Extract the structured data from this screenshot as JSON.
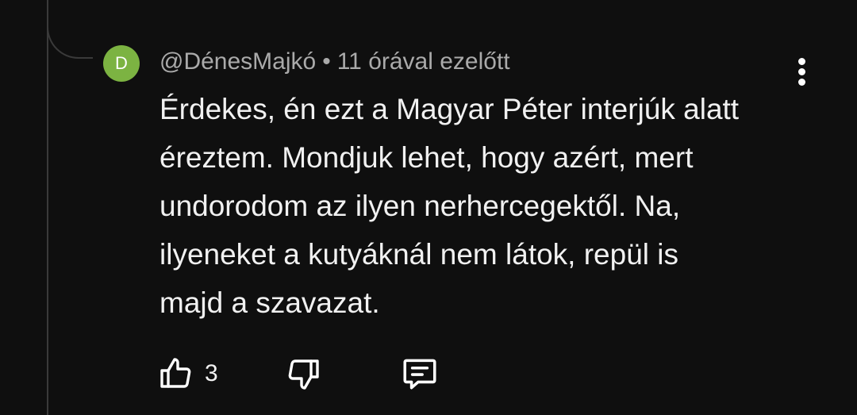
{
  "comment": {
    "avatar_letter": "D",
    "avatar_color": "#7cb342",
    "author": "@DénesMajkó",
    "separator": "•",
    "time": "11 órával ezelőtt",
    "lines": [
      "Érdekes, én ezt a Magyar Péter interjúk alatt",
      "éreztem. Mondjuk lehet, hogy azért, mert",
      "undorodom az ilyen nerhercegektől. Na,",
      "ilyeneket a kutyáknál nem látok, repül is",
      "majd a szavazat."
    ],
    "like_count": "3"
  },
  "icons": {
    "like": "thumbs-up-icon",
    "dislike": "thumbs-down-icon",
    "reply": "reply-comment-icon",
    "more": "more-vertical-icon"
  }
}
